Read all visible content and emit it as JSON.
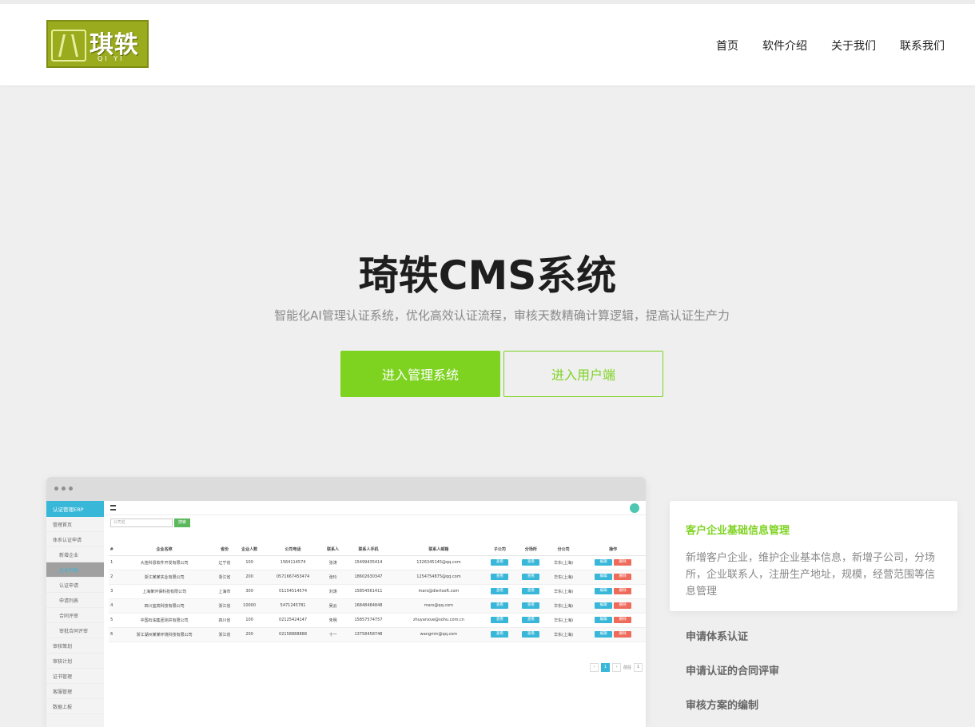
{
  "header": {
    "logo_text": "琪轶",
    "logo_subtext": "QI YI",
    "nav": [
      "首页",
      "软件介绍",
      "关于我们",
      "联系我们"
    ]
  },
  "hero": {
    "title": "琦轶CMS系统",
    "subtitle": "智能化AI管理认证系统，优化高效认证流程，审核天数精确计算逻辑，提高认证生产力",
    "primary_button": "进入管理系统",
    "secondary_button": "进入用户端"
  },
  "mock": {
    "brand": "认证管理ERP",
    "sidebar": [
      "管理首页",
      "体系认证申请",
      "新增企业",
      "企业列表",
      "认证申请",
      "申请列表",
      "合同评审",
      "审批合同评审",
      "审核策划",
      "审核计划",
      "证书管理",
      "客服管理",
      "数据上报"
    ],
    "search_placeholder": "公司名",
    "search_button": "搜索",
    "table": {
      "headers": [
        "#",
        "企业名称",
        "省份",
        "企业人数",
        "公司电话",
        "联系人",
        "联系人手机",
        "联系人邮箱",
        "子公司",
        "分场所",
        "分公司",
        "操作"
      ],
      "rows": [
        [
          "1",
          "大连科恩软件开发有限公司",
          "辽宁省",
          "100",
          "1564114574",
          "张涛",
          "15499435414",
          "1326345145@qq.com",
          "查看",
          "查看",
          "华东(上海)",
          "编辑"
        ],
        [
          "2",
          "浙江某某实业有限公司",
          "浙江省",
          "200",
          "0571667453474",
          "张玲",
          "18602630347",
          "1254754875@qq.com",
          "查看",
          "查看",
          "华东(上海)",
          "编辑"
        ],
        [
          "3",
          "上海某环保科技有限公司",
          "上海市",
          "300",
          "01154514574",
          "刘涛",
          "15854561411",
          "mars@dlertsoft.com",
          "查看",
          "查看",
          "华东(上海)",
          "编辑"
        ],
        [
          "4",
          "四川宜宾科技有限公司",
          "浙江省",
          "10000",
          "5471245781",
          "吴云",
          "16848484848",
          "mars@qq.com",
          "查看",
          "查看",
          "华东(上海)",
          "编辑"
        ],
        [
          "5",
          "中国石油集团测井有限公司",
          "四川省",
          "100",
          "02125424147",
          "朱明",
          "15857574757",
          "zhuyanxue@sohu.com.cn",
          "查看",
          "查看",
          "华东(上海)",
          "编辑"
        ],
        [
          "6",
          "浙江湖州某某环境科技有限公司",
          "浙江省",
          "200",
          "02158888888",
          "十一",
          "13758458748",
          "wangmin@qq.com",
          "查看",
          "查看",
          "华东(上海)",
          "编辑"
        ]
      ],
      "delete_label": "删除"
    },
    "pager_current": "1",
    "pager_goto": "前往"
  },
  "features": {
    "active_title": "客户企业基础信息管理",
    "active_desc": "新增客户企业，维护企业基本信息，新增子公司，分场所，企业联系人，注册生产地址，规模，经营范围等信息管理",
    "items": [
      "申请体系认证",
      "申请认证的合同评审",
      "审核方案的编制"
    ]
  },
  "colors": {
    "accent": "#7ed321",
    "mock_blue": "#39b7d8"
  }
}
